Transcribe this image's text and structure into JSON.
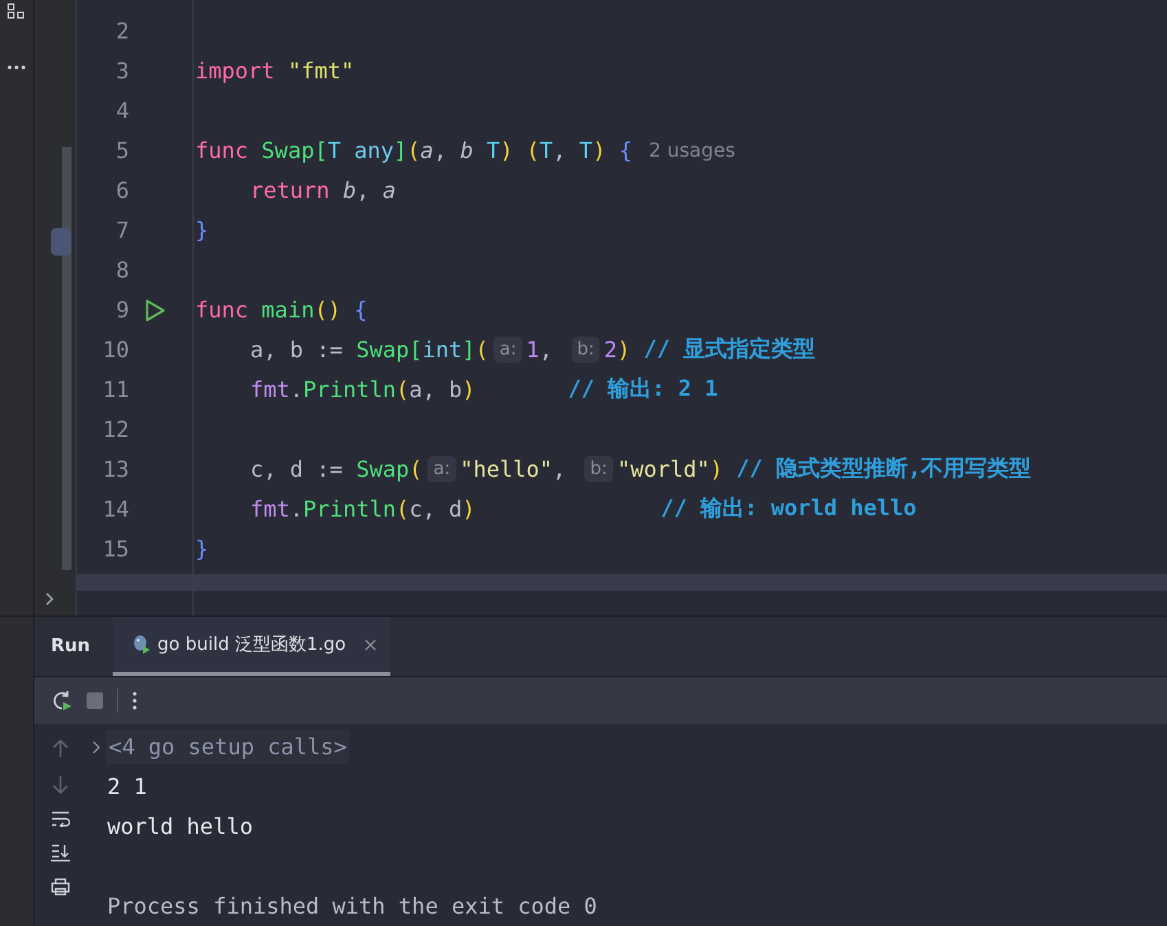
{
  "editor": {
    "lines": [
      {
        "number": "2",
        "runnable": false
      },
      {
        "number": "3",
        "runnable": false,
        "indented": false,
        "segments": [
          {
            "kind": "code",
            "tokens": [
              {
                "t": "import ",
                "kind": "kw"
              },
              {
                "t": "\"fmt\"",
                "kind": "str"
              }
            ]
          }
        ]
      },
      {
        "number": "4",
        "runnable": false
      },
      {
        "number": "5",
        "runnable": false,
        "indented": false,
        "segments": [
          {
            "kind": "code",
            "tokens": [
              {
                "t": "func ",
                "kind": "kw"
              },
              {
                "t": "Swap",
                "kind": "fn"
              },
              {
                "t": "[",
                "kind": "bg"
              },
              {
                "t": "T ",
                "kind": "type"
              },
              {
                "t": "any",
                "kind": "any"
              },
              {
                "t": "]",
                "kind": "bg"
              },
              {
                "t": "(",
                "kind": "by"
              },
              {
                "t": "a",
                "kind": "param"
              },
              {
                "t": ", ",
                "kind": "id"
              },
              {
                "t": "b ",
                "kind": "param"
              },
              {
                "t": "T",
                "kind": "type"
              },
              {
                "t": ") ",
                "kind": "by"
              },
              {
                "t": "(",
                "kind": "by"
              },
              {
                "t": "T",
                "kind": "type"
              },
              {
                "t": ", ",
                "kind": "id"
              },
              {
                "t": "T",
                "kind": "type"
              },
              {
                "t": ") ",
                "kind": "by"
              },
              {
                "t": "{",
                "kind": "bb"
              }
            ]
          },
          {
            "kind": "usage",
            "text": "2 usages"
          }
        ]
      },
      {
        "number": "6",
        "runnable": false,
        "indented": true,
        "segments": [
          {
            "kind": "code",
            "tokens": [
              {
                "t": "return ",
                "kind": "kw"
              },
              {
                "t": "b",
                "kind": "param"
              },
              {
                "t": ", ",
                "kind": "id"
              },
              {
                "t": "a",
                "kind": "param"
              }
            ]
          }
        ]
      },
      {
        "number": "7",
        "runnable": false,
        "indented": false,
        "segments": [
          {
            "kind": "code",
            "tokens": [
              {
                "t": "}",
                "kind": "bb"
              }
            ]
          }
        ]
      },
      {
        "number": "8",
        "runnable": false
      },
      {
        "number": "9",
        "runnable": true,
        "indented": false,
        "segments": [
          {
            "kind": "code",
            "tokens": [
              {
                "t": "func ",
                "kind": "kw"
              },
              {
                "t": "main",
                "kind": "fn"
              },
              {
                "t": "() ",
                "kind": "by"
              },
              {
                "t": "{",
                "kind": "bb"
              }
            ]
          }
        ]
      },
      {
        "number": "10",
        "runnable": false,
        "indented": true,
        "segments": [
          {
            "kind": "code",
            "tokens": [
              {
                "t": "a, b := ",
                "kind": "id"
              },
              {
                "t": "Swap",
                "kind": "fn"
              },
              {
                "t": "[",
                "kind": "bg"
              },
              {
                "t": "int",
                "kind": "any"
              },
              {
                "t": "]",
                "kind": "bg"
              },
              {
                "t": "(",
                "kind": "by"
              }
            ]
          },
          {
            "kind": "hint",
            "text": "a:"
          },
          {
            "kind": "code",
            "tokens": [
              {
                "t": "1",
                "kind": "num"
              },
              {
                "t": ", ",
                "kind": "id"
              }
            ]
          },
          {
            "kind": "hint",
            "text": "b:"
          },
          {
            "kind": "code",
            "tokens": [
              {
                "t": "2",
                "kind": "num"
              },
              {
                "t": ") ",
                "kind": "by"
              }
            ]
          },
          {
            "kind": "comment",
            "text": "// 显式指定类型"
          }
        ]
      },
      {
        "number": "11",
        "runnable": false,
        "indented": true,
        "segments": [
          {
            "kind": "code",
            "tokens": [
              {
                "t": "fmt",
                "kind": "pkg"
              },
              {
                "t": ".",
                "kind": "id"
              },
              {
                "t": "Println",
                "kind": "fn"
              },
              {
                "t": "(",
                "kind": "by"
              },
              {
                "t": "a, b",
                "kind": "id"
              },
              {
                "t": ")       ",
                "kind": "by"
              }
            ]
          },
          {
            "kind": "comment",
            "text": "// 输出: 2 1"
          }
        ]
      },
      {
        "number": "12",
        "runnable": false
      },
      {
        "number": "13",
        "runnable": false,
        "indented": true,
        "segments": [
          {
            "kind": "code",
            "tokens": [
              {
                "t": "c, d := ",
                "kind": "id"
              },
              {
                "t": "Swap",
                "kind": "fn"
              },
              {
                "t": "(",
                "kind": "by"
              }
            ]
          },
          {
            "kind": "hint",
            "text": "a:"
          },
          {
            "kind": "code",
            "tokens": [
              {
                "t": "\"hello\"",
                "kind": "str2"
              },
              {
                "t": ", ",
                "kind": "id"
              }
            ]
          },
          {
            "kind": "hint",
            "text": "b:"
          },
          {
            "kind": "code",
            "tokens": [
              {
                "t": "\"world\"",
                "kind": "str2"
              },
              {
                "t": ") ",
                "kind": "by"
              }
            ]
          },
          {
            "kind": "comment",
            "text": "// 隐式类型推断,不用写类型"
          }
        ]
      },
      {
        "number": "14",
        "runnable": false,
        "indented": true,
        "segments": [
          {
            "kind": "code",
            "tokens": [
              {
                "t": "fmt",
                "kind": "pkg"
              },
              {
                "t": ".",
                "kind": "id"
              },
              {
                "t": "Println",
                "kind": "fn"
              },
              {
                "t": "(",
                "kind": "by"
              },
              {
                "t": "c, d",
                "kind": "id"
              },
              {
                "t": ")              ",
                "kind": "by"
              }
            ]
          },
          {
            "kind": "comment",
            "text": "// 输出: world hello"
          }
        ]
      },
      {
        "number": "15",
        "runnable": false,
        "indented": false,
        "segments": [
          {
            "kind": "code",
            "tokens": [
              {
                "t": "}",
                "kind": "bb"
              }
            ]
          }
        ]
      }
    ]
  },
  "run_panel": {
    "title": "Run",
    "tabs": [
      {
        "label": "go build 泛型函数1.go",
        "selected": true
      }
    ],
    "toolbar": [
      {
        "kind": "rerun",
        "disabled": false
      },
      {
        "kind": "stop",
        "disabled": true
      },
      {
        "kind": "more",
        "disabled": false
      }
    ],
    "side_tools": [
      {
        "kind": "up",
        "disabled": true
      },
      {
        "kind": "down",
        "disabled": true
      },
      {
        "kind": "wrap",
        "disabled": false
      },
      {
        "kind": "scroll-end",
        "disabled": false
      },
      {
        "kind": "print",
        "disabled": false
      }
    ],
    "console": [
      {
        "kind": "folded",
        "text": "<4 go setup calls>"
      },
      {
        "kind": "output",
        "text": "2 1"
      },
      {
        "kind": "output",
        "text": "world hello"
      },
      {
        "kind": "blank"
      },
      {
        "kind": "system",
        "text": "Process finished with the exit code 0"
      }
    ]
  }
}
